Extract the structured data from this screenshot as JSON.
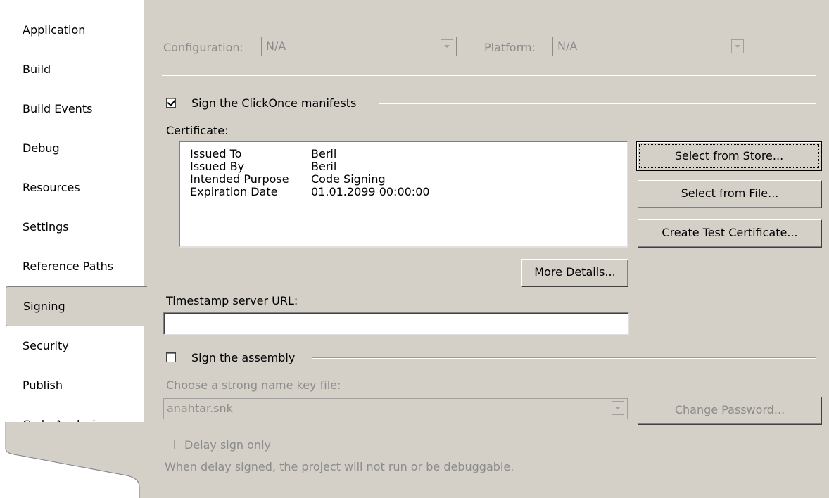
{
  "sidebar": {
    "items": [
      {
        "label": "Application"
      },
      {
        "label": "Build"
      },
      {
        "label": "Build Events"
      },
      {
        "label": "Debug"
      },
      {
        "label": "Resources"
      },
      {
        "label": "Settings"
      },
      {
        "label": "Reference Paths"
      },
      {
        "label": "Signing",
        "selected": true
      },
      {
        "label": "Security"
      },
      {
        "label": "Publish"
      },
      {
        "label": "Code Analysis"
      }
    ]
  },
  "config": {
    "configuration_label": "Configuration:",
    "configuration_value": "N/A",
    "platform_label": "Platform:",
    "platform_value": "N/A"
  },
  "clickonce": {
    "checkbox_label": "Sign the ClickOnce manifests",
    "checked": true,
    "certificate_label": "Certificate:",
    "fields": [
      {
        "key": "Issued To",
        "value": "Beril"
      },
      {
        "key": "Issued By",
        "value": "Beril"
      },
      {
        "key": "Intended Purpose",
        "value": "Code Signing"
      },
      {
        "key": "Expiration Date",
        "value": "01.01.2099 00:00:00"
      }
    ],
    "select_store_button": "Select from Store...",
    "select_file_button": "Select from File...",
    "create_test_button": "Create Test Certificate...",
    "more_details_button": "More Details...",
    "timestamp_label": "Timestamp server URL:",
    "timestamp_value": ""
  },
  "assembly": {
    "checkbox_label": "Sign the assembly",
    "checked": false,
    "keyfile_label": "Choose a strong name key file:",
    "keyfile_value": "anahtar.snk",
    "change_password_button": "Change Password...",
    "delay_sign_label": "Delay sign only",
    "delay_note": "When delay signed, the project will not run or be debuggable."
  },
  "colors": {
    "background": "#d4d0c8",
    "sidebar": "#ffffff",
    "disabled_text": "#8c8c8c"
  }
}
